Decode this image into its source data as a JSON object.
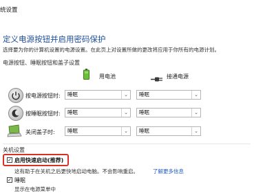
{
  "window": {
    "title": "统设置"
  },
  "page": {
    "heading": "定义电源按钮并启用密码保护",
    "description": "选择要为你的计算机设置的电源设置。在此页上对设置所做的更改将应用于你所有的电源计划。"
  },
  "power_section": {
    "label": "电源按钮、睡眠按钮和盖子设置",
    "columns": {
      "battery": "用电池",
      "plugged": "接通电源"
    },
    "rows": [
      {
        "label": "按电源按钮时:",
        "battery": "睡眠",
        "plugged": "睡眠"
      },
      {
        "label": "按睡眠按钮时:",
        "battery": "睡眠",
        "plugged": "睡眠"
      },
      {
        "label": "关闭盖子时:",
        "battery": "睡眠",
        "plugged": "睡眠"
      }
    ]
  },
  "shutdown_section": {
    "label": "关机设置",
    "items": [
      {
        "label": "启用快速启动(推荐)",
        "checked": true,
        "desc": "这有助于在关机之后更快地启动电脑。不会影响重启。",
        "link": "了解更多信息"
      },
      {
        "label": "睡眠",
        "checked": true,
        "desc": "显示在电源菜单中"
      }
    ]
  },
  "icons": {
    "battery": "battery-icon",
    "plug": "power-plug-icon",
    "power_button": "power-button-icon",
    "sleep_button": "sleep-button-icon",
    "lid": "laptop-lid-icon"
  },
  "colors": {
    "heading": "#1f4e99",
    "link": "#1f5bbf",
    "highlight": "#d93025"
  }
}
